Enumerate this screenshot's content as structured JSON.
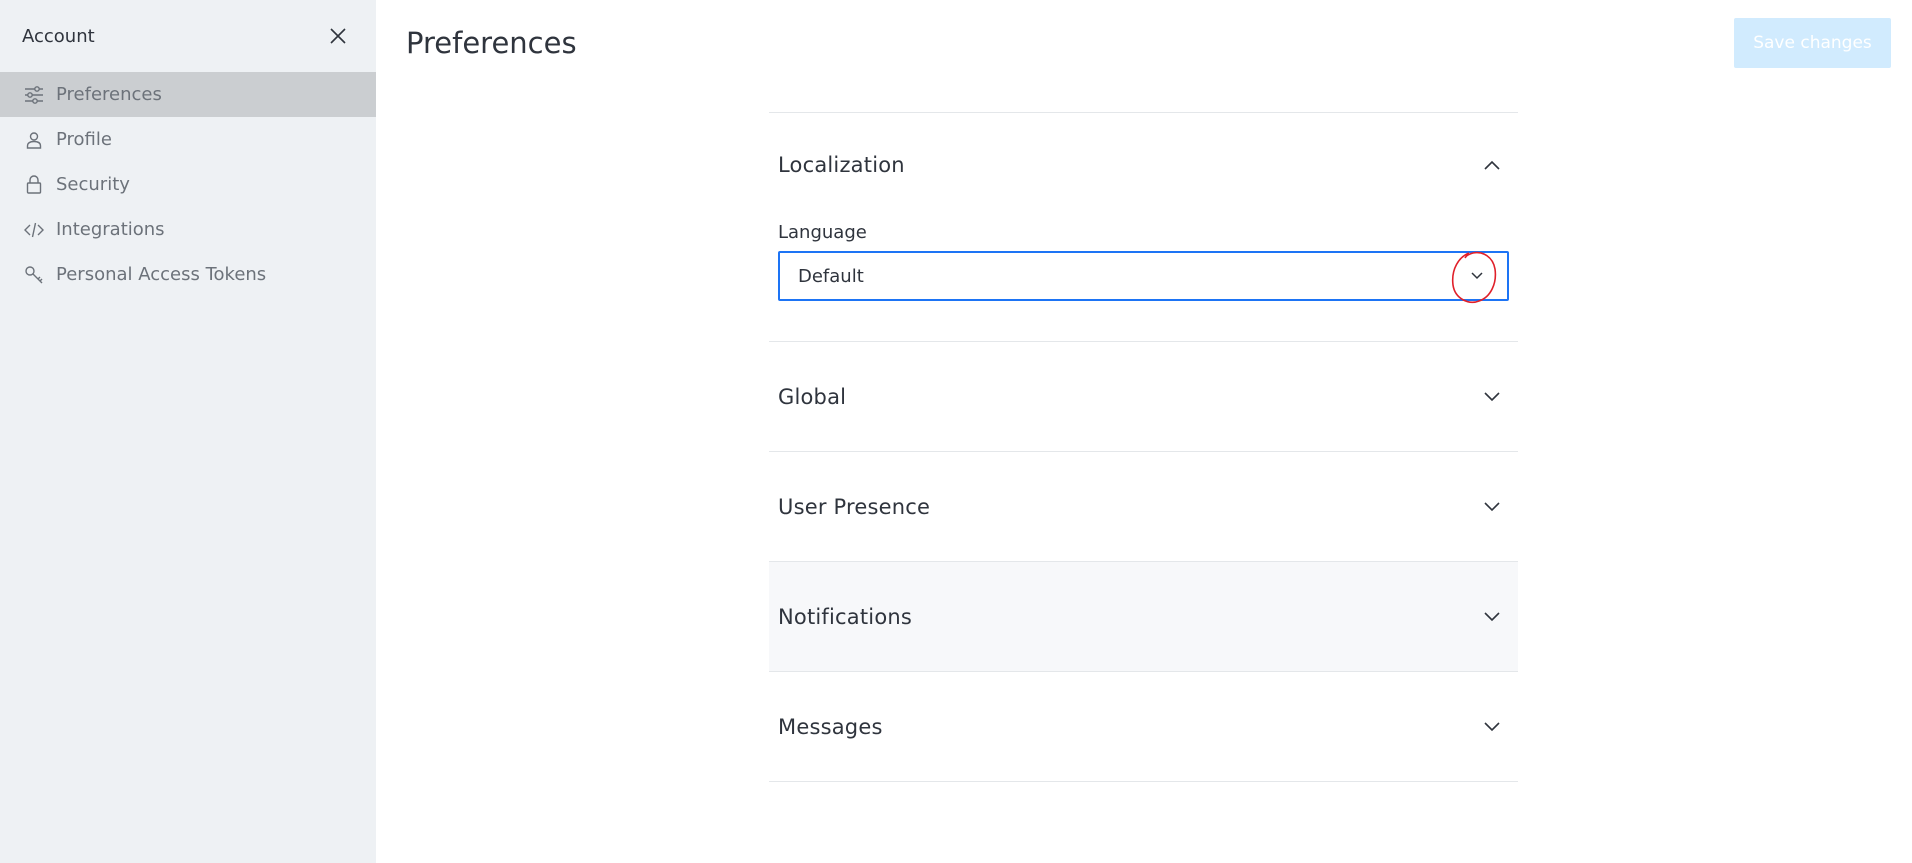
{
  "sidebar": {
    "title": "Account",
    "items": [
      {
        "label": "Preferences",
        "icon": "sliders-icon",
        "active": true
      },
      {
        "label": "Profile",
        "icon": "user-icon",
        "active": false
      },
      {
        "label": "Security",
        "icon": "lock-icon",
        "active": false
      },
      {
        "label": "Integrations",
        "icon": "code-icon",
        "active": false
      },
      {
        "label": "Personal Access Tokens",
        "icon": "key-icon",
        "active": false
      }
    ]
  },
  "header": {
    "title": "Preferences",
    "save_label": "Save changes"
  },
  "sections": [
    {
      "title": "Localization",
      "expanded": true
    },
    {
      "title": "Global",
      "expanded": false
    },
    {
      "title": "User Presence",
      "expanded": false
    },
    {
      "title": "Notifications",
      "expanded": false
    },
    {
      "title": "Messages",
      "expanded": false
    }
  ],
  "localization": {
    "language_label": "Language",
    "language_value": "Default"
  },
  "colors": {
    "sidebar_bg": "#eef1f4",
    "active_item_bg": "#cbced1",
    "focus_border": "#1d74f5",
    "save_button_bg": "#d1ebfe",
    "annotation": "#e0202a"
  }
}
